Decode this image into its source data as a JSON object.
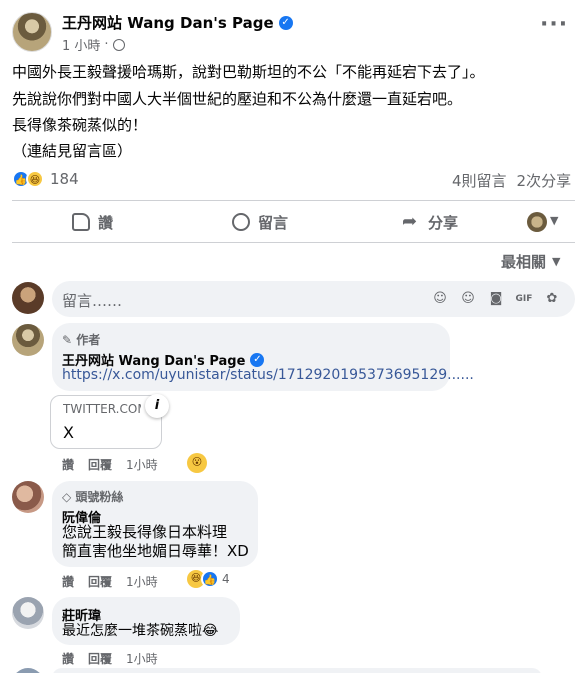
{
  "post": {
    "author": "王丹网站 Wang Dan's Page",
    "time": "1 小時",
    "lines": [
      "中國外長王毅聲援哈瑪斯，說對巴勒斯坦的不公「不能再延宕下去了」。",
      "先說說你們對中國人大半個世紀的壓迫和不公為什麼還一直延宕吧。",
      "長得像茶碗蒸似的！",
      "（連結見留言區）"
    ],
    "reaction_count": "184",
    "comment_count": "4則留言",
    "share_count": "2次分享"
  },
  "actions": {
    "like": "讚",
    "comment": "留言",
    "share": "分享"
  },
  "sort_label": "最相關",
  "composer": {
    "placeholder": "留言……"
  },
  "comments": [
    {
      "badge": "作者",
      "name": "王丹网站 Wang Dan's Page",
      "link": "https://x.com/uyunistar/status/1712920195373695129......",
      "preview_domain": "TWITTER.COM",
      "preview_title": "X",
      "like": "讚",
      "reply": "回覆",
      "time": "1小時"
    },
    {
      "badge": "頭號粉絲",
      "name": "阮偉倫",
      "lines": [
        "您說王毅長得像日本料理",
        "簡直害他坐地媚日辱華！XD"
      ],
      "like": "讚",
      "reply": "回覆",
      "time": "1小時",
      "reaction_count": "4"
    },
    {
      "name": "莊昕瑋",
      "lines": [
        "最近怎麼一堆茶碗蒸啦😂"
      ],
      "like": "讚",
      "reply": "回覆",
      "time": "1小時"
    }
  ]
}
